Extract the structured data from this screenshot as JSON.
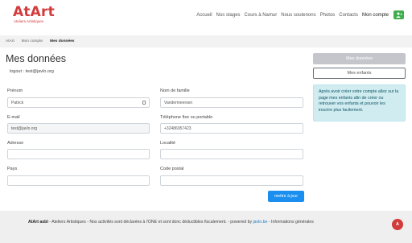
{
  "brand": {
    "name": "AtArt",
    "tagline": "Ateliers Artistiques"
  },
  "nav": {
    "items": [
      "Accueil",
      "Nos stages",
      "Cours à Namur",
      "Nous soutenons",
      "Photos",
      "Contacts"
    ],
    "current": "Mon compte",
    "user_icon": "user-add-icon"
  },
  "breadcrumb": [
    "AtArt",
    "Mon compte",
    "Mes données"
  ],
  "page": {
    "title": "Mes données",
    "logout": "logout : test@javlo.org"
  },
  "form": {
    "prenom_label": "Prénom",
    "prenom_value": "Patrick",
    "nom_label": "Nom de famille",
    "nom_value": "Vandermeersen",
    "email_label": "E-mail",
    "email_value": "test@javlo.org",
    "phone_label": "Téléphone fixe ou portable",
    "phone_value": "+32486957423",
    "adresse_label": "Adresse",
    "adresse_value": "",
    "localite_label": "Localité",
    "localite_value": "",
    "pays_label": "Pays",
    "pays_value": "",
    "cp_label": "Code postal",
    "cp_value": "",
    "submit_label": "mettre à jour"
  },
  "sidebar": {
    "btn_donnees": "Mes données",
    "btn_enfants": "Mes enfants",
    "info": "Après avoir créer votre compte allez sur la page mes enfants afin de créer ou retrouver vos enfants et pouvoir les inscrire plus facilement."
  },
  "footer": {
    "org": "AtArt asbl",
    "text": " - Ateliers Artistiques - Nos activités sont déclarées à l'ONE et sont donc déductibles fiscalement. - powered by ",
    "link": "javlo.be",
    "tail": " - Informations générales",
    "badge": "A"
  },
  "colors": {
    "brand": "#d33b3b",
    "primary": "#1b8ff0",
    "success": "#3fae4f",
    "info_bg": "#d1ecf1"
  }
}
